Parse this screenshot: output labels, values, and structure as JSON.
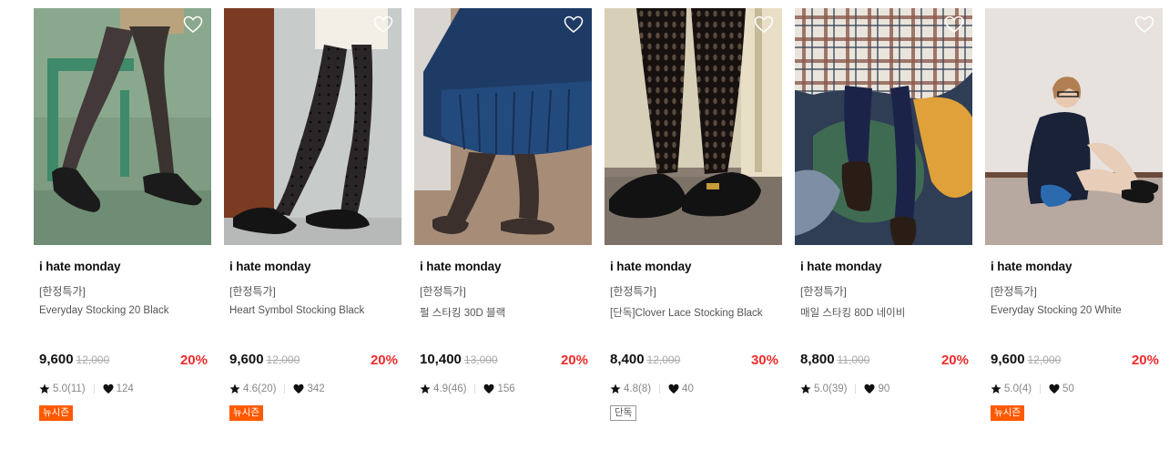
{
  "products": [
    {
      "brand": "i hate monday",
      "promo": "[한정특가]",
      "name": "Everyday Stocking 20 Black",
      "price": "9,600",
      "original": "12,000",
      "discount": "20%",
      "rating": "5.0(11)",
      "likes": "124",
      "tag": "뉴시즌",
      "tag_style": "new",
      "image_icon": "product-photo"
    },
    {
      "brand": "i hate monday",
      "promo": "[한정특가]",
      "name": "Heart Symbol Stocking Black",
      "price": "9,600",
      "original": "12,000",
      "discount": "20%",
      "rating": "4.6(20)",
      "likes": "342",
      "tag": "뉴시즌",
      "tag_style": "new",
      "image_icon": "product-photo"
    },
    {
      "brand": "i hate monday",
      "promo": "[한정특가]",
      "name": "펄 스타킹 30D 블랙",
      "price": "10,400",
      "original": "13,000",
      "discount": "20%",
      "rating": "4.9(46)",
      "likes": "156",
      "tag": "",
      "tag_style": "",
      "image_icon": "product-photo"
    },
    {
      "brand": "i hate monday",
      "promo": "[한정특가]",
      "name": "[단독]Clover Lace Stocking Black",
      "price": "8,400",
      "original": "12,000",
      "discount": "30%",
      "rating": "4.8(8)",
      "likes": "40",
      "tag": "단독",
      "tag_style": "excl",
      "image_icon": "product-photo"
    },
    {
      "brand": "i hate monday",
      "promo": "[한정특가]",
      "name": "매일 스타킹 80D 네이비",
      "price": "8,800",
      "original": "11,000",
      "discount": "20%",
      "rating": "5.0(39)",
      "likes": "90",
      "tag": "",
      "tag_style": "",
      "image_icon": "product-photo"
    },
    {
      "brand": "i hate monday",
      "promo": "[한정특가]",
      "name": "Everyday Stocking 20 White",
      "price": "9,600",
      "original": "12,000",
      "discount": "20%",
      "rating": "5.0(4)",
      "likes": "50",
      "tag": "뉴시즌",
      "tag_style": "new",
      "image_icon": "product-photo"
    }
  ],
  "icons": {
    "wishlist": "heart-outline-icon",
    "rating": "star-icon",
    "likes": "heart-filled-icon"
  },
  "colors": {
    "discount": "#f02b2b",
    "new_season_tag": "#ff5a00",
    "price": "#111111"
  }
}
